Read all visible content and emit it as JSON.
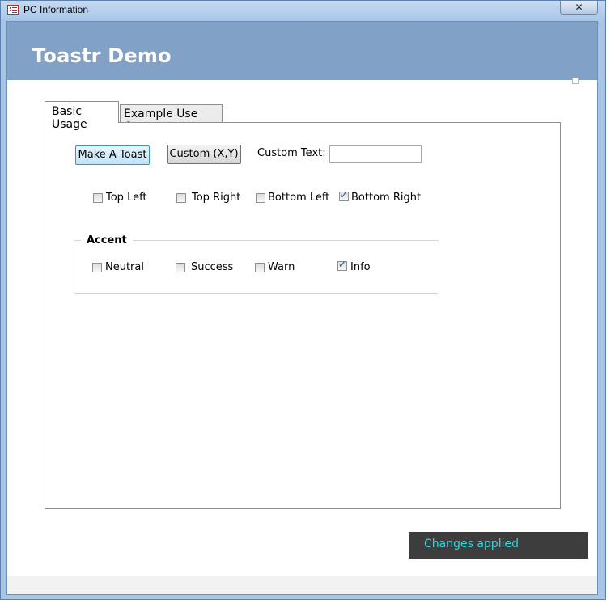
{
  "window": {
    "title": "PC Information",
    "close_symbol": "✕",
    "icon": "form-icon"
  },
  "header": {
    "title": "Toastr Demo",
    "background_color": "#82a1c6"
  },
  "tabs": [
    {
      "label": "Basic Usage",
      "selected": true
    },
    {
      "label": "Example Use Case",
      "selected": false
    }
  ],
  "controls": {
    "make_toast_label": "Make A Toast",
    "custom_xy_label": "Custom (X,Y)",
    "custom_text_label": "Custom Text:",
    "custom_text_value": ""
  },
  "positions": [
    {
      "label": "Top Left",
      "checked": false
    },
    {
      "label": "Top Right",
      "checked": false
    },
    {
      "label": "Bottom Left",
      "checked": false
    },
    {
      "label": "Bottom Right",
      "checked": true
    }
  ],
  "accent": {
    "title": "Accent",
    "options": [
      {
        "label": "Neutral",
        "checked": false
      },
      {
        "label": "Success",
        "checked": false
      },
      {
        "label": "Warn",
        "checked": false
      },
      {
        "label": "Info",
        "checked": true
      }
    ]
  },
  "toast": {
    "message": "Changes applied",
    "background_color": "#3d3d3d",
    "text_color": "#33d6e0"
  }
}
